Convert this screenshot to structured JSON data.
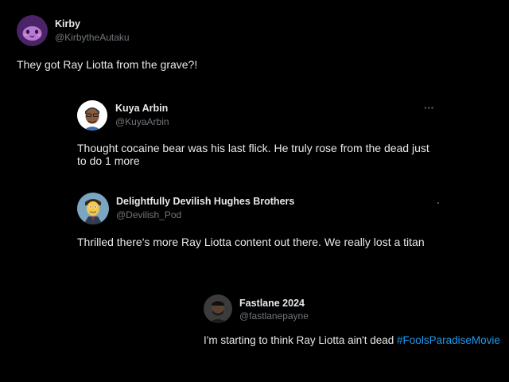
{
  "posts": [
    {
      "name": "Kirby",
      "handle": "@KirbytheAutaku",
      "text": "They got Ray Liotta from the grave?!",
      "avatar_icon": "kirby-avatar-icon",
      "avatar_color": "#5b2d7a"
    },
    {
      "name": "Kuya Arbin",
      "handle": "@KuyaArbin",
      "text_line1": "Thought cocaine bear was his last flick. He truly rose from the dead just",
      "text_line2": "to do 1 more",
      "avatar_icon": "memoji-avatar-icon",
      "more_icon": "···"
    },
    {
      "name": "Delightfully Devilish Hughes Brothers",
      "handle": "@Devilish_Pod",
      "text": "Thrilled there's more Ray Liotta content out there.  We really lost a titan",
      "avatar_icon": "cartoon-avatar-icon"
    },
    {
      "name": "Fastlane 2024",
      "handle": "@fastlanepayne",
      "text": "I'm starting to think Ray Liotta ain't dead ",
      "hashtag": "#FoolsParadiseMovie",
      "avatar_icon": "photo-avatar-icon"
    }
  ],
  "colors": {
    "background": "#000000",
    "text": "#e7e9ea",
    "secondary": "#71767b",
    "link": "#1d9bf0"
  }
}
